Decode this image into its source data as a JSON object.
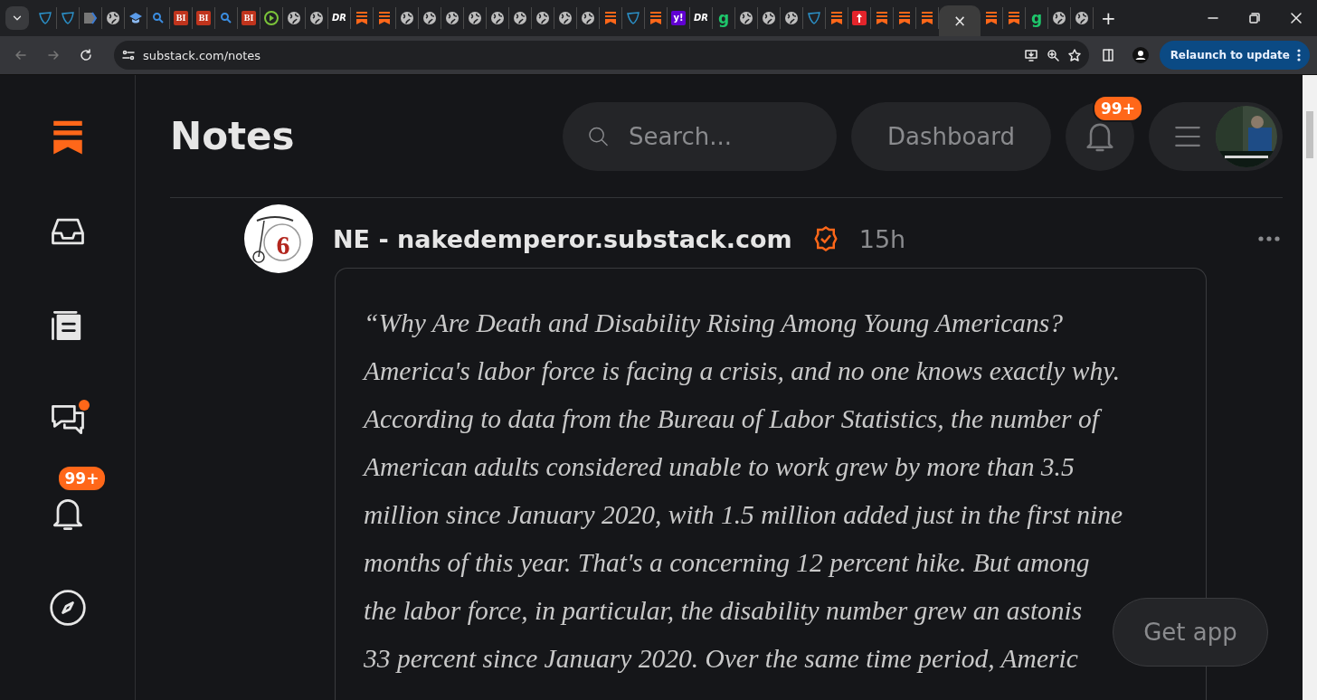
{
  "browser": {
    "tabs": [
      {
        "kind": "shield",
        "selected": false
      },
      {
        "kind": "shield",
        "selected": false
      },
      {
        "kind": "tag",
        "selected": false
      },
      {
        "kind": "globe",
        "selected": false
      },
      {
        "kind": "cap",
        "selected": false
      },
      {
        "kind": "search",
        "selected": false
      },
      {
        "kind": "bi",
        "glyph": "BI",
        "selected": false
      },
      {
        "kind": "bi",
        "glyph": "BI",
        "selected": false
      },
      {
        "kind": "search",
        "selected": false
      },
      {
        "kind": "bi",
        "glyph": "BI",
        "selected": false
      },
      {
        "kind": "play",
        "selected": false
      },
      {
        "kind": "globe",
        "selected": false
      },
      {
        "kind": "globe",
        "selected": false
      },
      {
        "kind": "dr",
        "glyph": "DR",
        "selected": false
      },
      {
        "kind": "substack",
        "selected": false
      },
      {
        "kind": "substack",
        "selected": false
      },
      {
        "kind": "globe",
        "selected": false
      },
      {
        "kind": "globe",
        "selected": false
      },
      {
        "kind": "globe",
        "selected": false
      },
      {
        "kind": "globe",
        "selected": false
      },
      {
        "kind": "globe",
        "selected": false
      },
      {
        "kind": "globe",
        "selected": false
      },
      {
        "kind": "globe",
        "selected": false
      },
      {
        "kind": "globe",
        "selected": false
      },
      {
        "kind": "globe",
        "selected": false
      },
      {
        "kind": "substack",
        "selected": false
      },
      {
        "kind": "shield",
        "selected": false
      },
      {
        "kind": "substack",
        "selected": false
      },
      {
        "kind": "yahoo",
        "glyph": "y!",
        "selected": false
      },
      {
        "kind": "dr",
        "glyph": "DR",
        "selected": false
      },
      {
        "kind": "g",
        "glyph": "g",
        "selected": false
      },
      {
        "kind": "globe",
        "selected": false
      },
      {
        "kind": "globe",
        "selected": false
      },
      {
        "kind": "globe",
        "selected": false
      },
      {
        "kind": "shield",
        "selected": false
      },
      {
        "kind": "substack",
        "selected": false
      },
      {
        "kind": "pin",
        "selected": false
      },
      {
        "kind": "substack",
        "selected": false
      },
      {
        "kind": "substack",
        "selected": false
      },
      {
        "kind": "substack",
        "selected": false
      },
      {
        "close": "×",
        "selected": true
      },
      {
        "kind": "substack",
        "selected": false
      },
      {
        "kind": "substack",
        "selected": false
      },
      {
        "kind": "g",
        "glyph": "g",
        "selected": false
      },
      {
        "kind": "globe",
        "selected": false
      },
      {
        "kind": "globe",
        "selected": false
      }
    ],
    "new_tab": "+",
    "address": "substack.com/notes",
    "relaunch": "Relaunch to update"
  },
  "sidebar": [
    {
      "kind": "logo",
      "dot": false
    },
    {
      "kind": "inbox",
      "dot": false
    },
    {
      "kind": "reader",
      "dot": false
    },
    {
      "kind": "chat",
      "dot": true
    },
    {
      "kind": "bell",
      "dot": false,
      "badge": "99+"
    },
    {
      "kind": "explore",
      "dot": false
    }
  ],
  "header": {
    "title": "Notes",
    "search": {
      "placeholder": "Search..."
    },
    "dashboard": "Dashboard",
    "notifications_badge": "99+"
  },
  "post": {
    "avatar_glyph": "6",
    "author": "NE - nakedemperor.substack.com",
    "verified": true,
    "time": "15h",
    "lines": [
      "“Why Are Death and Disability Rising Among Young Americans?",
      "America's labor force is facing a crisis, and no one knows exactly why.",
      "According to data from the Bureau of Labor Statistics, the number of",
      "American adults considered unable to work grew by more than 3.5",
      "million since January 2020, with 1.5 million added just in the first nine",
      "months of this year. That's a concerning 12 percent hike. But among",
      "the labor force, in particular, the disability number grew an astonis",
      "33 percent since January 2020. Over the same time period, Americ"
    ]
  },
  "get_app": "Get app"
}
